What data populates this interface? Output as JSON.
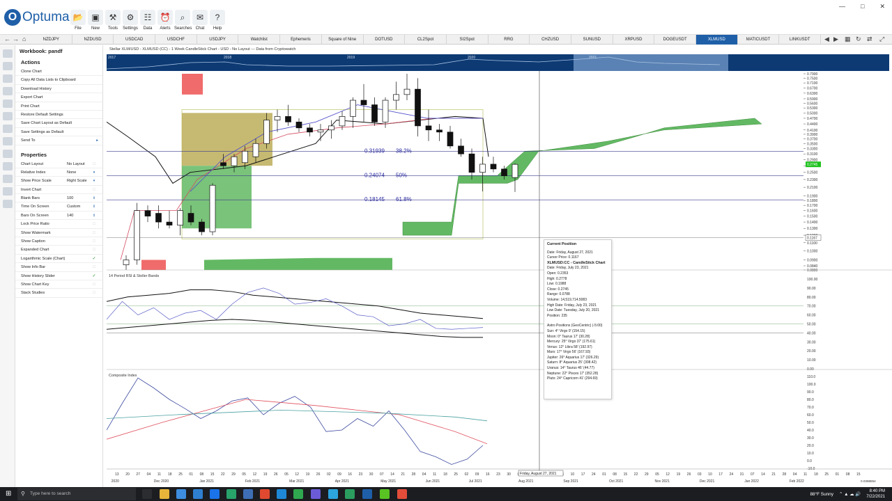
{
  "app": {
    "logo_letter": "O",
    "logo_text": "Optuma",
    "ribbon": [
      {
        "label": "File",
        "icon": "folder-icon"
      },
      {
        "label": "New",
        "icon": "new-icon"
      },
      {
        "label": "Tools",
        "icon": "tools-icon"
      },
      {
        "label": "Settings",
        "icon": "gear-icon"
      },
      {
        "label": "Data",
        "icon": "data-icon"
      },
      {
        "label": "Alerts",
        "icon": "alarm-icon"
      },
      {
        "label": "Searches",
        "icon": "search-icon"
      },
      {
        "label": "Chat",
        "icon": "chat-icon"
      },
      {
        "label": "Help",
        "icon": "help-icon"
      }
    ]
  },
  "tabs": [
    "NZDJPY",
    "NZDUSD",
    "USDCAD",
    "USDCHF",
    "USDJPY",
    "Watchlist",
    "Ephemeris",
    "Square of Nine",
    "DOTUSD",
    "CL2Spot",
    "SI2Spot",
    "RRG",
    "CHZUSD",
    "SUNUSD",
    "XRPUSD",
    "DOGEUSDT",
    "XLMUSD",
    "MATICUSDT",
    "LINKUSDT"
  ],
  "active_tab": "XLMUSD",
  "panel": {
    "workbook": "Workbook: pandf",
    "actions_title": "Actions",
    "actions": [
      "Clone Chart",
      "Copy All Data Lists to Clipboard",
      "Download History",
      "Export Chart",
      "Print Chart",
      "Restore Default Settings",
      "Save Chart Layout as Default",
      "Save Settings as Default",
      "Send To"
    ],
    "properties_title": "Properties",
    "properties": [
      {
        "k": "Chart Layout",
        "v": "No Layout",
        "c": ""
      },
      {
        "k": "Relative Index",
        "v": "None",
        "c": "dd"
      },
      {
        "k": "Show Price Scale",
        "v": "Right Scale",
        "c": "dd"
      },
      {
        "k": "Invert Chart",
        "v": "",
        "c": ""
      },
      {
        "k": "Blank Bars",
        "v": "100",
        "c": "sp"
      },
      {
        "k": "Time On Screen",
        "v": "Custom",
        "c": "sp"
      },
      {
        "k": "Bars On Screen",
        "v": "140",
        "c": "sp"
      },
      {
        "k": "Lock Price Ratio",
        "v": "",
        "c": ""
      },
      {
        "k": "Show Watermark",
        "v": "",
        "c": ""
      },
      {
        "k": "Show Caption",
        "v": "",
        "c": ""
      },
      {
        "k": "Expanded Chart",
        "v": "",
        "c": ""
      },
      {
        "k": "Logarithmic Scale (Chart)",
        "v": "",
        "c": "ck"
      },
      {
        "k": "Show Info Bar",
        "v": "",
        "c": ""
      },
      {
        "k": "Show History Slider",
        "v": "",
        "c": "ck"
      },
      {
        "k": "Show Chart Key",
        "v": "",
        "c": ""
      },
      {
        "k": "Stack Studies",
        "v": "",
        "c": ""
      }
    ]
  },
  "chart": {
    "title": "Stellar XLM/USD - XLMUSD (CC) - 1 Week CandleStick Chart - USD - No Layout --- Data from Cryptowatch",
    "slider_years": [
      "2017",
      "2018",
      "2019",
      "2020",
      "2021"
    ],
    "fib_levels": [
      {
        "price": "0.31939",
        "pct": "38.2%"
      },
      {
        "price": "0.24074",
        "pct": "50%"
      },
      {
        "price": "0.18145",
        "pct": "61.8%"
      }
    ],
    "price_scale": [
      "0.7900",
      "0.7500",
      "0.7100",
      "0.6700",
      "0.6300",
      "0.5900",
      "0.5600",
      "0.5300",
      "0.5000",
      "0.4700",
      "0.4400",
      "0.4100",
      "0.3900",
      "0.3700",
      "0.3500",
      "0.3300",
      "0.3100",
      "0.2900",
      "0.2700",
      "0.2500",
      "0.2300",
      "0.2100",
      "0.1900",
      "0.1800",
      "0.1700",
      "0.1600",
      "0.1500",
      "0.1400",
      "0.1300",
      "0.1200",
      "0.1100",
      "0.1000",
      "0.0900",
      "0.0840",
      "0.0800"
    ],
    "current_price_label": "0.2745",
    "cursor_price_label": "0.1167",
    "rsi_title": "14 Period RSI & Stoller Bands",
    "rsi_scale": [
      "100.00",
      "90.00",
      "80.00",
      "70.00",
      "60.00",
      "50.00",
      "40.00",
      "30.00",
      "20.00",
      "10.00",
      "0.00"
    ],
    "ci_title": "Composite Index",
    "ci_scale": [
      "110.0",
      "100.0",
      "90.0",
      "80.0",
      "70.0",
      "60.0",
      "50.0",
      "40.0",
      "30.0",
      "20.0",
      "10.0",
      "0.0",
      "-10.0"
    ],
    "x_days": [
      "13",
      "20",
      "27",
      "04",
      "11",
      "18",
      "25",
      "01",
      "08",
      "15",
      "22",
      "29",
      "05",
      "12",
      "19",
      "26",
      "05",
      "12",
      "19",
      "26",
      "02",
      "09",
      "16",
      "23",
      "30",
      "07",
      "14",
      "21",
      "28",
      "04",
      "11",
      "18",
      "25",
      "02",
      "09",
      "16",
      "23",
      "30",
      "06",
      "13",
      "20",
      "27",
      "03",
      "10",
      "17",
      "24",
      "01",
      "08",
      "15",
      "22",
      "29",
      "05",
      "12",
      "19",
      "26",
      "03",
      "10",
      "17",
      "24",
      "31",
      "07",
      "14",
      "21",
      "28",
      "04",
      "11",
      "18",
      "25",
      "01",
      "08",
      "15"
    ],
    "x_months": [
      {
        "label": "2020",
        "at": 0.006
      },
      {
        "label": "Dec 2020",
        "at": 0.06
      },
      {
        "label": "Jan 2021",
        "at": 0.118
      },
      {
        "label": "Feb 2021",
        "at": 0.176
      },
      {
        "label": "Mar 2021",
        "at": 0.232
      },
      {
        "label": "Apr 2021",
        "at": 0.29
      },
      {
        "label": "May 2021",
        "at": 0.348
      },
      {
        "label": "Jun 2021",
        "at": 0.405
      },
      {
        "label": "Jul 2021",
        "at": 0.46
      },
      {
        "label": "Aug 2021",
        "at": 0.523
      },
      {
        "label": "Sep 2021",
        "at": 0.58
      },
      {
        "label": "Oct 2021",
        "at": 0.638
      },
      {
        "label": "Nov 2021",
        "at": 0.696
      },
      {
        "label": "Dec 2021",
        "at": 0.753
      },
      {
        "label": "Jan 2022",
        "at": 0.81
      },
      {
        "label": "Feb 2022",
        "at": 0.867
      }
    ],
    "cursor_date_label": "Friday, August 27, 2021",
    "bottom_right_value": "0.0388854"
  },
  "tooltip": {
    "header": "Current Position",
    "date": "Date: Friday, August 27, 2021",
    "cursor_price": "Cursor Price: 0.1167",
    "bar_title": "XLMUSD:CC - CandleStick Chart",
    "bar_lines": [
      "Date: Friday, July 23, 2021",
      "Open: 0.2353",
      "High: 0.2778",
      "Low: 0.1988",
      "Close: 0.2745",
      "Range: 0.0788",
      "Volume: 14,519,714.5083",
      "High Date: Friday, July 23, 2021",
      "Low Date: Tuesday, July 20, 2021",
      "Position: 235"
    ],
    "astro_lines": [
      "Astro Positions (GeoCentric) (-5:00)",
      "Sun: 4° Virgo 9' (154.15)",
      "Moon: 0° Taurus 17' (30.28)",
      "Mercury: 25° Virgo 37' (175.61)",
      "Venus: 12° Libra 58' (192.97)",
      "Mars: 17° Virgo 56' (167.93)",
      "Jupiter: 26° Aquarius 17' (326.29)",
      "Saturn: 8° Aquarius 25' (308.42)",
      "Uranus: 14° Taurus 46' (44.77)",
      "Neptune: 22° Pisces 17' (352.28)",
      "Pluto: 24° Capricorn 41' (294.69)"
    ]
  },
  "taskbar": {
    "search_placeholder": "Type here to search",
    "weather": "88°F  Sunny",
    "time": "8:40 PM",
    "date": "7/22/2021"
  },
  "chart_data": {
    "type": "candlestick",
    "symbol": "XLMUSD",
    "title": "Stellar XLM/USD - XLMUSD (CC) - 1 Week CandleStick Chart - USD - No Layout --- Data from Cryptowatch",
    "log_scale": true,
    "ylim": [
      0.08,
      0.79
    ],
    "candles": [
      {
        "o": 0.085,
        "h": 0.095,
        "l": 0.08,
        "c": 0.09
      },
      {
        "o": 0.09,
        "h": 0.175,
        "l": 0.085,
        "c": 0.16
      },
      {
        "o": 0.16,
        "h": 0.17,
        "l": 0.14,
        "c": 0.15
      },
      {
        "o": 0.155,
        "h": 0.17,
        "l": 0.13,
        "c": 0.14
      },
      {
        "o": 0.14,
        "h": 0.16,
        "l": 0.13,
        "c": 0.135
      },
      {
        "o": 0.135,
        "h": 0.165,
        "l": 0.12,
        "c": 0.16
      },
      {
        "o": 0.155,
        "h": 0.17,
        "l": 0.135,
        "c": 0.14
      },
      {
        "o": 0.14,
        "h": 0.145,
        "l": 0.12,
        "c": 0.125
      },
      {
        "o": 0.125,
        "h": 0.22,
        "l": 0.12,
        "c": 0.215
      },
      {
        "o": 0.28,
        "h": 0.31,
        "l": 0.26,
        "c": 0.27
      },
      {
        "o": 0.27,
        "h": 0.31,
        "l": 0.25,
        "c": 0.3
      },
      {
        "o": 0.28,
        "h": 0.34,
        "l": 0.26,
        "c": 0.32
      },
      {
        "o": 0.3,
        "h": 0.37,
        "l": 0.28,
        "c": 0.35
      },
      {
        "o": 0.35,
        "h": 0.5,
        "l": 0.33,
        "c": 0.46
      },
      {
        "o": 0.46,
        "h": 0.52,
        "l": 0.4,
        "c": 0.48
      },
      {
        "o": 0.48,
        "h": 0.55,
        "l": 0.43,
        "c": 0.45
      },
      {
        "o": 0.45,
        "h": 0.47,
        "l": 0.4,
        "c": 0.42
      },
      {
        "o": 0.42,
        "h": 0.44,
        "l": 0.38,
        "c": 0.4
      },
      {
        "o": 0.4,
        "h": 0.44,
        "l": 0.36,
        "c": 0.41
      },
      {
        "o": 0.41,
        "h": 0.46,
        "l": 0.37,
        "c": 0.43
      },
      {
        "o": 0.43,
        "h": 0.51,
        "l": 0.41,
        "c": 0.48
      },
      {
        "o": 0.48,
        "h": 0.6,
        "l": 0.42,
        "c": 0.58
      },
      {
        "o": 0.58,
        "h": 0.7,
        "l": 0.45,
        "c": 0.55
      },
      {
        "o": 0.55,
        "h": 0.6,
        "l": 0.43,
        "c": 0.45
      },
      {
        "o": 0.45,
        "h": 0.6,
        "l": 0.42,
        "c": 0.58
      },
      {
        "o": 0.58,
        "h": 0.72,
        "l": 0.52,
        "c": 0.62
      },
      {
        "o": 0.62,
        "h": 0.79,
        "l": 0.58,
        "c": 0.66
      },
      {
        "o": 0.66,
        "h": 0.75,
        "l": 0.38,
        "c": 0.43
      },
      {
        "o": 0.43,
        "h": 0.52,
        "l": 0.36,
        "c": 0.41
      },
      {
        "o": 0.41,
        "h": 0.44,
        "l": 0.36,
        "c": 0.4
      },
      {
        "o": 0.4,
        "h": 0.43,
        "l": 0.33,
        "c": 0.34
      },
      {
        "o": 0.34,
        "h": 0.37,
        "l": 0.3,
        "c": 0.31
      },
      {
        "o": 0.31,
        "h": 0.33,
        "l": 0.23,
        "c": 0.25
      },
      {
        "o": 0.25,
        "h": 0.3,
        "l": 0.2,
        "c": 0.275
      },
      {
        "o": 0.275,
        "h": 0.3,
        "l": 0.25,
        "c": 0.26
      },
      {
        "o": 0.26,
        "h": 0.27,
        "l": 0.23,
        "c": 0.24
      },
      {
        "o": 0.2353,
        "h": 0.2778,
        "l": 0.1988,
        "c": 0.2745
      }
    ],
    "fibonacci": [
      {
        "price": 0.31939,
        "pct": "38.2%"
      },
      {
        "price": 0.24074,
        "pct": "50%"
      },
      {
        "price": 0.18145,
        "pct": "61.8%"
      }
    ],
    "ichimoku_cloud_future": [
      0.24,
      0.3,
      0.33,
      0.34,
      0.35,
      0.37,
      0.4,
      0.43,
      0.45,
      0.46,
      0.46,
      0.46,
      0.47,
      0.45
    ],
    "rsi": [
      55,
      75,
      60,
      68,
      55,
      62,
      65,
      55,
      72,
      85,
      90,
      84,
      72,
      74,
      78,
      70,
      60,
      58,
      48,
      50,
      55,
      45,
      44,
      45,
      46
    ],
    "rsi_upper": [
      75,
      80,
      82,
      84,
      88,
      88,
      86,
      82,
      80,
      78,
      76,
      74,
      72,
      70,
      66,
      62,
      60,
      58,
      56
    ],
    "rsi_lower": [
      44,
      46,
      48,
      50,
      52,
      54,
      55,
      54,
      52,
      50,
      48,
      46,
      44,
      42,
      40,
      38,
      36,
      35,
      35
    ],
    "composite_index": [
      40,
      75,
      108,
      95,
      80,
      68,
      55,
      65,
      78,
      82,
      60,
      75,
      84,
      70,
      38,
      40,
      55,
      45,
      65,
      40,
      12,
      5,
      -5,
      2,
      20
    ]
  }
}
